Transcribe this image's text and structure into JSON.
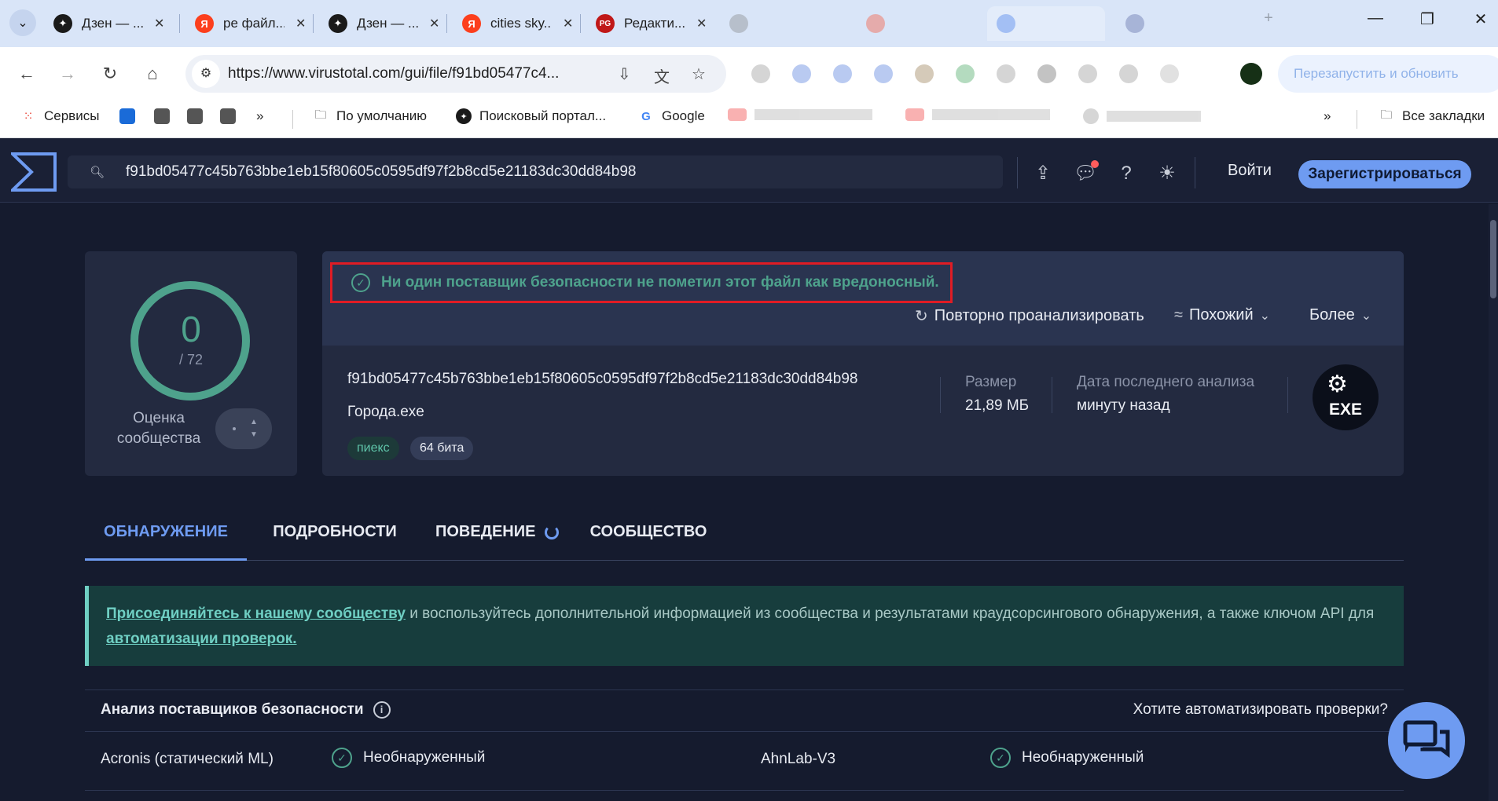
{
  "browser": {
    "tabs": [
      {
        "title": "Дзен — ...",
        "favicon": "dzen-icon",
        "color": "#1a1a1a",
        "glyph": "✦"
      },
      {
        "title": "ре файл...",
        "favicon": "yandex-icon",
        "color": "#fc3f1d",
        "glyph": "Я"
      },
      {
        "title": "Дзен — ...",
        "favicon": "dzen-icon",
        "color": "#1a1a1a",
        "glyph": "✦"
      },
      {
        "title": "cities sky...",
        "favicon": "yandex-icon",
        "color": "#fc3f1d",
        "glyph": "Я"
      },
      {
        "title": "Редакти...",
        "favicon": "playground-icon",
        "color": "#c01818",
        "glyph": "PG"
      }
    ],
    "url": "https://www.virustotal.com/gui/file/f91bd05477c4...",
    "bookmarks": {
      "services": "Сервисы",
      "default_folder": "По умолчанию",
      "search_portal": "Поисковый портал...",
      "google": "Google",
      "all_bookmarks": "Все закладки"
    }
  },
  "header": {
    "search_value": "f91bd05477c45b763bbe1eb15f80605c0595df97f2b8cd5e21183dc30dd84b98",
    "login": "Войти",
    "signup": "Зарегистрироваться"
  },
  "score": {
    "detections": "0",
    "total": "/ 72",
    "community_label": "Оценка сообщества"
  },
  "summary": {
    "verdict": "Ни один поставщик безопасности не пометил этот файл как вредоносный.",
    "actions": {
      "reanalyze": "Повторно проанализировать",
      "similar": "Похожий",
      "more": "Более"
    },
    "hash": "f91bd05477c45b763bbe1eb15f80605c0595df97f2b8cd5e21183dc30dd84b98",
    "filename": "Города.exe",
    "tags": [
      "пиекс",
      "64 бита"
    ],
    "size_label": "Размер",
    "size_value": "21,89 МБ",
    "last_analysis_label": "Дата последнего анализа",
    "last_analysis_value": "минуту назад",
    "file_type_badge": "EXE"
  },
  "tabs": [
    "ОБНАРУЖЕНИЕ",
    "ПОДРОБНОСТИ",
    "ПОВЕДЕНИЕ",
    "СООБЩЕСТВО"
  ],
  "banner": {
    "link1": "Присоединяйтесь к нашему сообществу",
    "text1": " и воспользуйтесь дополнительной информацией из сообщества и результатами краудсорсингового обнаружения, а также ключом API для ",
    "link2": "автоматизации проверок."
  },
  "vendors": {
    "title": "Анализ поставщиков безопасности",
    "automate": "Хотите автоматизировать проверки?",
    "rows": [
      {
        "left_name": "Acronis (статический ML)",
        "left_result": "Необнаруженный",
        "right_name": "AhnLab-V3",
        "right_result": "Необнаруженный"
      }
    ]
  },
  "colors": {
    "accent": "#6e9bf1",
    "clean": "#4ea28c",
    "highlight_box": "#e01c24",
    "background": "#151b2e"
  }
}
